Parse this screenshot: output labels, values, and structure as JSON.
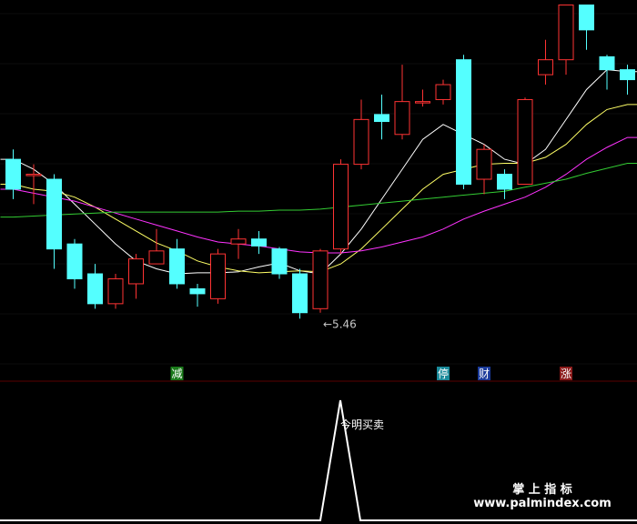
{
  "chart_data": [
    {
      "type": "candlestick",
      "price_ylim": [
        4.9,
        8.6
      ],
      "candles": [
        {
          "o": 7.0,
          "c": 6.7,
          "h": 7.1,
          "l": 6.6
        },
        {
          "o": 6.85,
          "c": 6.85,
          "h": 6.95,
          "l": 6.55
        },
        {
          "o": 6.8,
          "c": 6.1,
          "h": 6.85,
          "l": 5.9
        },
        {
          "o": 6.15,
          "c": 5.8,
          "h": 6.2,
          "l": 5.7
        },
        {
          "o": 5.85,
          "c": 5.55,
          "h": 5.95,
          "l": 5.5
        },
        {
          "o": 5.55,
          "c": 5.8,
          "h": 5.85,
          "l": 5.5
        },
        {
          "o": 5.75,
          "c": 6.0,
          "h": 6.05,
          "l": 5.6
        },
        {
          "o": 5.95,
          "c": 6.08,
          "h": 6.3,
          "l": 5.95
        },
        {
          "o": 6.1,
          "c": 5.75,
          "h": 6.2,
          "l": 5.7
        },
        {
          "o": 5.7,
          "c": 5.65,
          "h": 5.75,
          "l": 5.52
        },
        {
          "o": 5.6,
          "c": 6.05,
          "h": 6.1,
          "l": 5.55
        },
        {
          "o": 6.15,
          "c": 6.2,
          "h": 6.3,
          "l": 6.0
        },
        {
          "o": 6.2,
          "c": 6.13,
          "h": 6.28,
          "l": 6.05
        },
        {
          "o": 6.1,
          "c": 5.85,
          "h": 6.12,
          "l": 5.8
        },
        {
          "o": 5.85,
          "c": 5.46,
          "h": 5.9,
          "l": 5.4
        },
        {
          "o": 5.5,
          "c": 6.08,
          "h": 6.1,
          "l": 5.46
        },
        {
          "o": 6.1,
          "c": 6.95,
          "h": 7.0,
          "l": 6.05
        },
        {
          "o": 6.95,
          "c": 7.4,
          "h": 7.6,
          "l": 6.9
        },
        {
          "o": 7.45,
          "c": 7.38,
          "h": 7.65,
          "l": 7.2
        },
        {
          "o": 7.25,
          "c": 7.58,
          "h": 7.95,
          "l": 7.2
        },
        {
          "o": 7.58,
          "c": 7.58,
          "h": 7.7,
          "l": 7.53
        },
        {
          "o": 7.6,
          "c": 7.75,
          "h": 7.8,
          "l": 7.55
        },
        {
          "o": 8.0,
          "c": 6.75,
          "h": 8.05,
          "l": 6.7
        },
        {
          "o": 6.8,
          "c": 7.1,
          "h": 7.15,
          "l": 6.65
        },
        {
          "o": 6.85,
          "c": 6.7,
          "h": 6.9,
          "l": 6.6
        },
        {
          "o": 6.75,
          "c": 7.6,
          "h": 7.62,
          "l": 6.75
        },
        {
          "o": 7.85,
          "c": 8.0,
          "h": 8.2,
          "l": 7.75
        },
        {
          "o": 8.0,
          "c": 8.55,
          "h": 8.55,
          "l": 7.85
        },
        {
          "o": 8.55,
          "c": 8.3,
          "h": 8.55,
          "l": 8.1
        },
        {
          "o": 8.03,
          "c": 7.9,
          "h": 8.05,
          "l": 7.7
        },
        {
          "o": 7.9,
          "c": 7.8,
          "h": 7.95,
          "l": 7.65
        }
      ],
      "ma": [
        {
          "color": "#ffffff",
          "values": [
            7.0,
            6.9,
            6.75,
            6.55,
            6.35,
            6.15,
            5.98,
            5.9,
            5.85,
            5.86,
            5.86,
            5.87,
            5.92,
            5.96,
            5.88,
            5.85,
            6.05,
            6.3,
            6.6,
            6.9,
            7.2,
            7.35,
            7.25,
            7.15,
            7.0,
            6.95,
            7.1,
            7.4,
            7.7,
            7.9,
            7.88
          ]
        },
        {
          "color": "#ffff66",
          "values": [
            6.75,
            6.7,
            6.68,
            6.62,
            6.52,
            6.4,
            6.28,
            6.16,
            6.08,
            5.98,
            5.92,
            5.88,
            5.86,
            5.87,
            5.88,
            5.87,
            5.95,
            6.1,
            6.3,
            6.5,
            6.7,
            6.85,
            6.9,
            6.95,
            6.96,
            6.96,
            7.02,
            7.15,
            7.35,
            7.5,
            7.55
          ]
        },
        {
          "color": "#ff33ff",
          "values": [
            6.7,
            6.66,
            6.62,
            6.58,
            6.52,
            6.46,
            6.4,
            6.34,
            6.28,
            6.22,
            6.17,
            6.15,
            6.13,
            6.1,
            6.07,
            6.06,
            6.06,
            6.08,
            6.12,
            6.17,
            6.22,
            6.3,
            6.4,
            6.48,
            6.55,
            6.62,
            6.72,
            6.85,
            7.0,
            7.12,
            7.22
          ]
        },
        {
          "color": "#33cc33",
          "values": [
            6.42,
            6.43,
            6.44,
            6.45,
            6.46,
            6.47,
            6.47,
            6.47,
            6.47,
            6.47,
            6.47,
            6.48,
            6.48,
            6.49,
            6.49,
            6.5,
            6.52,
            6.54,
            6.56,
            6.58,
            6.6,
            6.62,
            6.64,
            6.66,
            6.68,
            6.72,
            6.76,
            6.8,
            6.86,
            6.91,
            6.96
          ]
        }
      ],
      "annotations": [
        {
          "index": 15,
          "text": "←5.46",
          "price": 5.46
        }
      ],
      "markers": [
        {
          "index": 8,
          "text": "减",
          "bg": "#1a7a1a",
          "fg": "#ffffff"
        },
        {
          "index": 21,
          "text": "停",
          "bg": "#1a8a9a",
          "fg": "#ffffff"
        },
        {
          "index": 23,
          "text": "财",
          "bg": "#1a3a9a",
          "fg": "#ffffff"
        },
        {
          "index": 27,
          "text": "涨",
          "bg": "#8a1a1a",
          "fg": "#ffffff"
        }
      ],
      "colors": {
        "up": "#ff3333",
        "down": "#54ffff"
      }
    },
    {
      "type": "line",
      "title": "今明买卖",
      "ylim": [
        0,
        1
      ],
      "x_range": [
        0,
        700
      ],
      "points": [
        [
          0,
          0
        ],
        [
          352,
          0
        ],
        [
          374,
          1
        ],
        [
          396,
          0
        ],
        [
          700,
          0
        ]
      ],
      "color": "#ffffff"
    }
  ],
  "watermark": {
    "line1": "掌 上 指 标",
    "line2": "www.palmindex.com"
  }
}
